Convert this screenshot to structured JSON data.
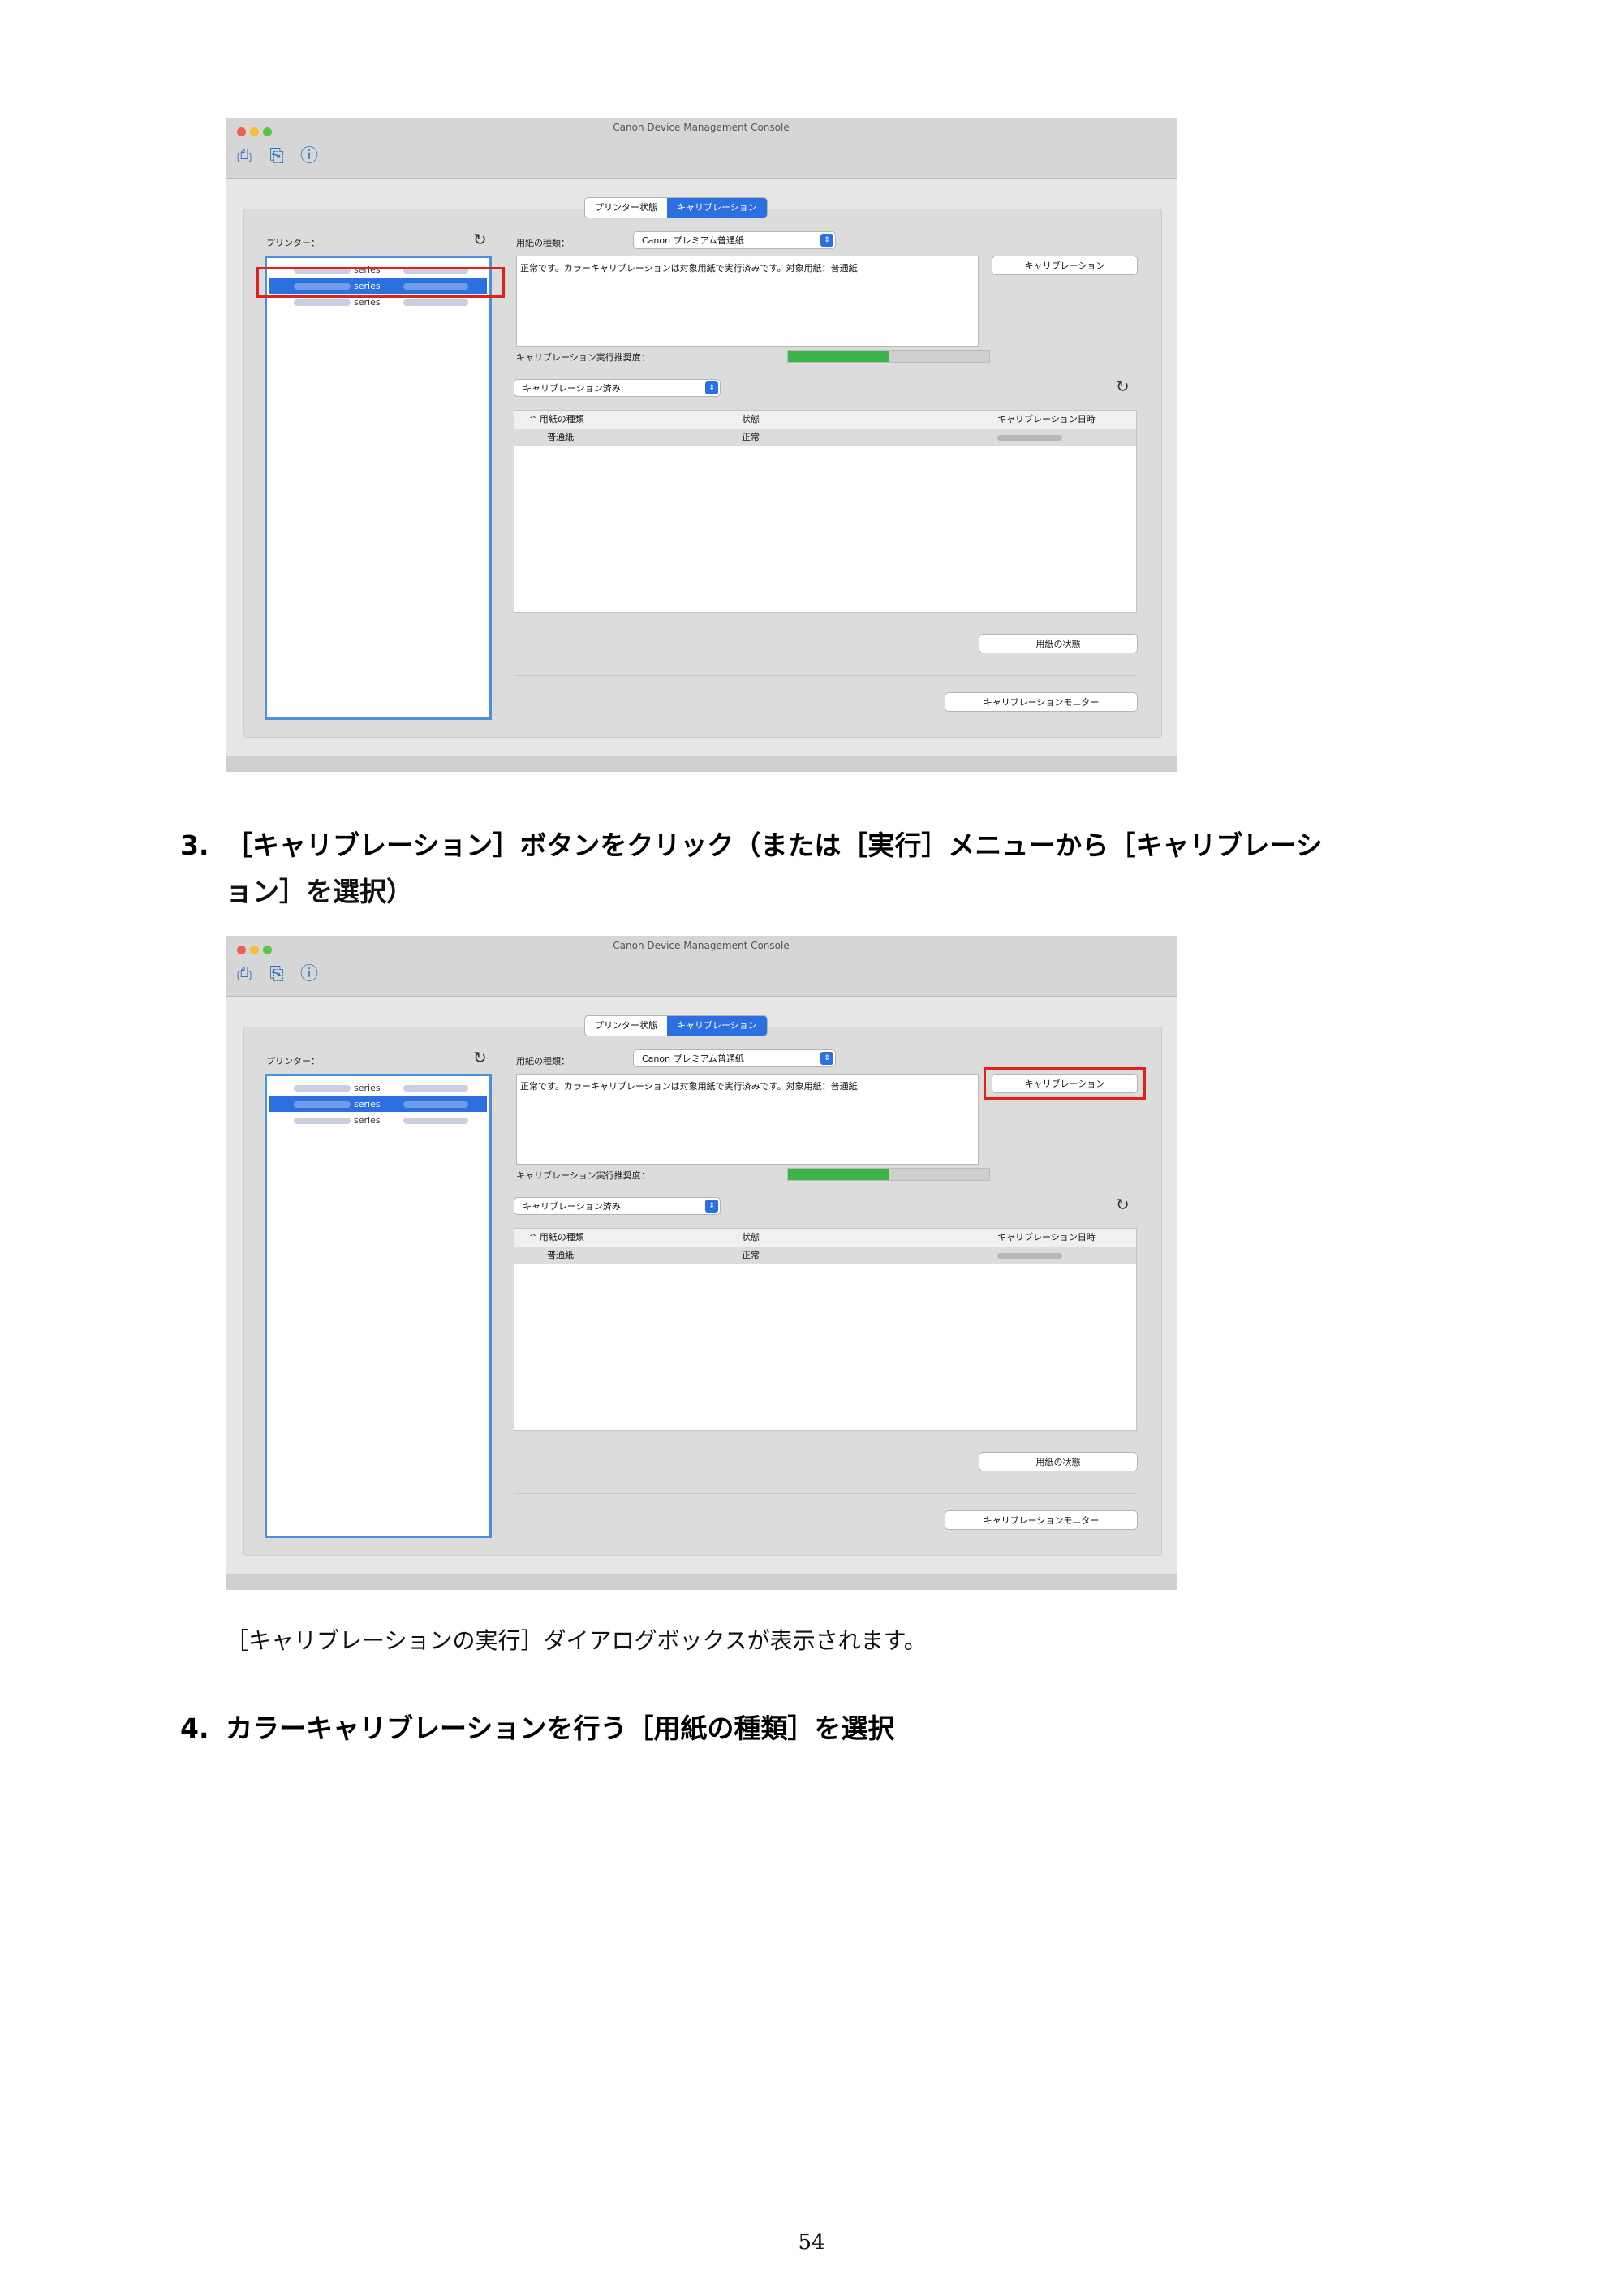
{
  "screenshot1": {
    "window_title": "Canon Device Management Console",
    "tabs": [
      "プリンター状態",
      "キャリブレーション"
    ],
    "printer_label": "プリンター：",
    "printers": [
      "series",
      "series",
      "series"
    ],
    "paper_type_label": "用紙の種類：",
    "paper_type_value": "Canon プレミアム普通紙",
    "message": "正常です。カラーキャリブレーションは対象用紙で実行済みです。対象用紙：普通紙",
    "calibrate_button": "キャリブレーション",
    "progress_label": "キャリブレーション実行推奨度：",
    "progress_value": 0.5,
    "filter_value": "キャリブレーション済み",
    "columns": [
      "^ 用紙の種類",
      "状態",
      "キャリブレーション日時"
    ],
    "rows": [
      [
        "普通紙",
        "正常"
      ]
    ],
    "paper_status_button": "用紙の状態",
    "monitor_button": "キャリブレーションモニター"
  },
  "step3": {
    "number": "3.",
    "line1": "［キャリブレーション］ボタンをクリック（または［実行］メニューから［キャリブレーシ",
    "line2": "ョン］を選択）"
  },
  "screenshot2": {
    "window_title": "Canon Device Management Console",
    "tabs": [
      "プリンター状態",
      "キャリブレーション"
    ],
    "printer_label": "プリンター：",
    "printers": [
      "series",
      "series",
      "series"
    ],
    "paper_type_label": "用紙の種類：",
    "paper_type_value": "Canon プレミアム普通紙",
    "message": "正常です。カラーキャリブレーションは対象用紙で実行済みです。対象用紙：普通紙",
    "calibrate_button": "キャリブレーション",
    "progress_label": "キャリブレーション実行推奨度：",
    "progress_value": 0.5,
    "filter_value": "キャリブレーション済み",
    "columns": [
      "^ 用紙の種類",
      "状態",
      "キャリブレーション日時"
    ],
    "rows": [
      [
        "普通紙",
        "正常"
      ]
    ],
    "paper_status_button": "用紙の状態",
    "monitor_button": "キャリブレーションモニター"
  },
  "note": "［キャリブレーションの実行］ダイアログボックスが表示されます。",
  "step4": {
    "number": "4.",
    "text": "カラーキャリブレーションを行う［用紙の種類］を選択"
  },
  "page_number": "54",
  "colors": {
    "accent": "#2c6fe0",
    "highlight": "#e0221a",
    "progress": "#3cb44a"
  }
}
